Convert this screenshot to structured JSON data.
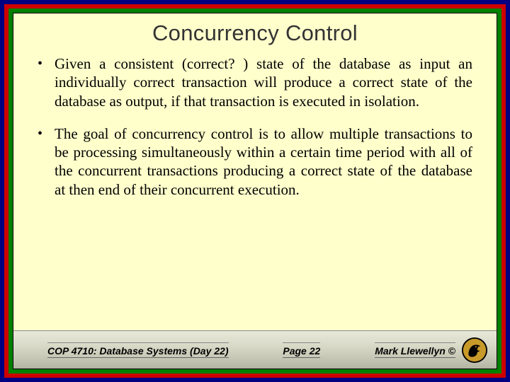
{
  "title": "Concurrency Control",
  "bullets": [
    "Given a consistent (correct? ) state of the database as input an individually correct transaction will produce a correct state of the database as output, if that transaction is executed in isolation.",
    "The goal of concurrency control is to allow multiple transactions to be processing simultaneously within a certain time period with all of the concurrent transactions producing a correct state of the database at then end of their concurrent execution."
  ],
  "footer": {
    "course": "COP 4710: Database Systems  (Day 22)",
    "page": "Page 22",
    "author": "Mark Llewellyn ©"
  },
  "colors": {
    "outer": "#010080",
    "red": "#cd0000",
    "green": "#008000",
    "panel": "#ffffcc"
  }
}
